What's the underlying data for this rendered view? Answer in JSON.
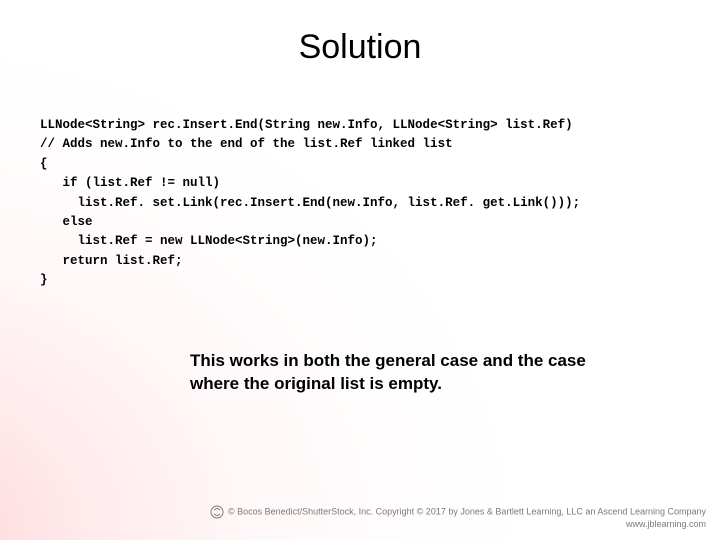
{
  "title": "Solution",
  "code": {
    "l1": "LLNode<String> rec.Insert.End(String new.Info, LLNode<String> list.Ref)",
    "l2": "// Adds new.Info to the end of the list.Ref linked list",
    "l3": "{",
    "l4": "   if (list.Ref != null)",
    "l5": "     list.Ref. set.Link(rec.Insert.End(new.Info, list.Ref. get.Link()));",
    "l6": "   else",
    "l7": "     list.Ref = new LLNode<String>(new.Info);",
    "l8": "   return list.Ref;",
    "l9": "}"
  },
  "explanation": "This works in both the general case and the case where the original list is empty.",
  "footer": {
    "line1": "© Bocos Benedict/ShutterStock, Inc. Copyright © 2017 by Jones & Bartlett Learning, LLC an Ascend Learning Company",
    "line2": "www.jblearning.com"
  }
}
